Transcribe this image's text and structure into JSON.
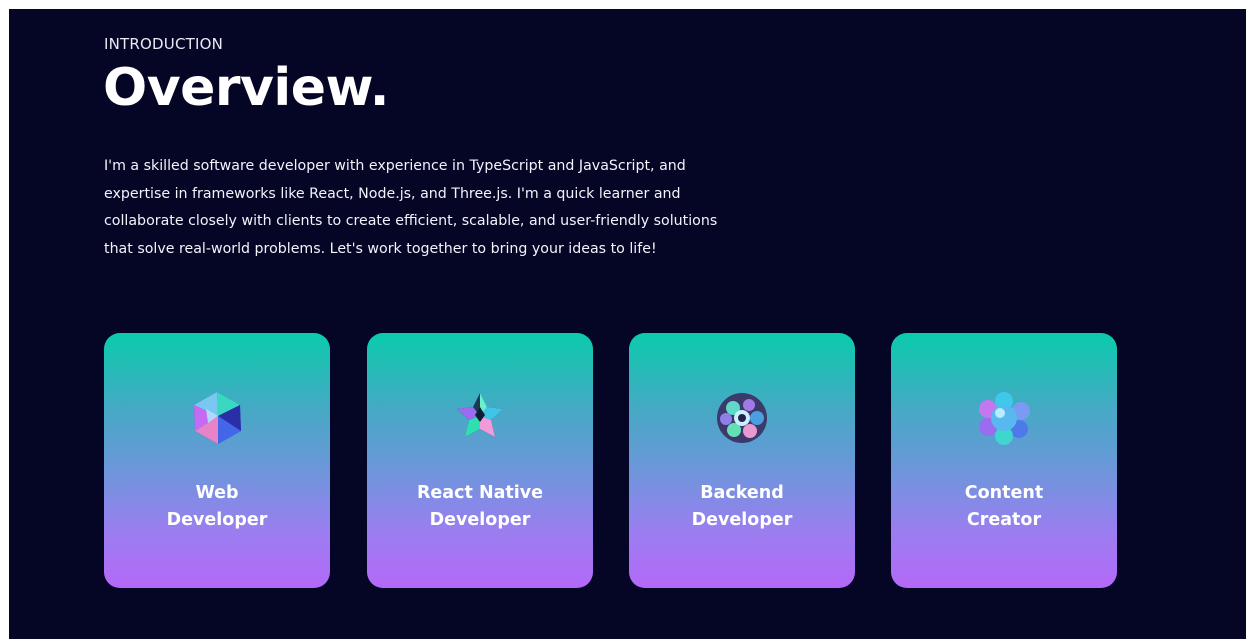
{
  "section": {
    "eyebrow": "INTRODUCTION",
    "title": "Overview.",
    "intro_lines": [
      "I'm a skilled software developer with experience in TypeScript and JavaScript, and",
      "expertise in frameworks like React, Node.js, and Three.js. I'm a quick learner and",
      "collaborate closely with clients to create efficient, scalable, and user-friendly solutions",
      "that solve real-world problems. Let's work together to bring your ideas to life!"
    ]
  },
  "cards": [
    {
      "icon": "web-developer-icon",
      "label": "Web\nDeveloper"
    },
    {
      "icon": "react-native-developer-icon",
      "label": "React Native\nDeveloper"
    },
    {
      "icon": "backend-developer-icon",
      "label": "Backend\nDeveloper"
    },
    {
      "icon": "content-creator-icon",
      "label": "Content\nCreator"
    }
  ],
  "colors": {
    "background": "#050526",
    "card_gradient_top": "#0acbac",
    "card_gradient_bottom": "#b468f8",
    "text": "#ffffff"
  }
}
